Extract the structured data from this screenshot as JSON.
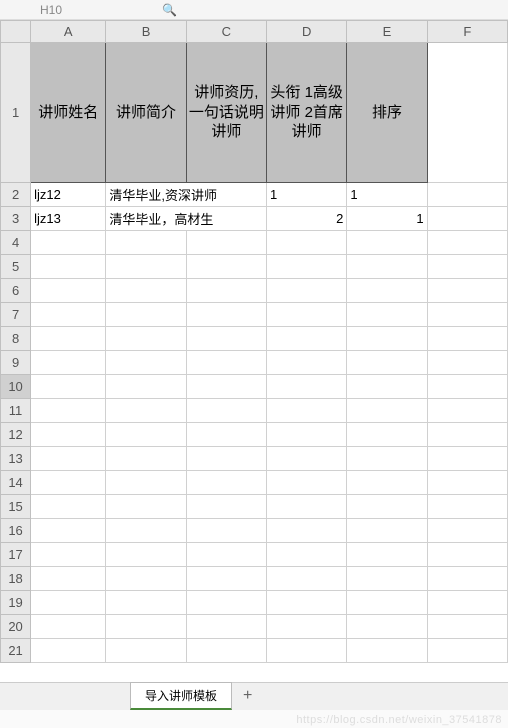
{
  "namebox": "H10",
  "columns": [
    "A",
    "B",
    "C",
    "D",
    "E",
    "F"
  ],
  "rowNumbers": [
    1,
    2,
    3,
    4,
    5,
    6,
    7,
    8,
    9,
    10,
    11,
    12,
    13,
    14,
    15,
    16,
    17,
    18,
    19,
    20,
    21
  ],
  "headers": {
    "A": "讲师姓名",
    "B": "讲师简介",
    "C": "讲师资历,一句话说明讲师",
    "D": "头衔 1高级讲师 2首席讲师",
    "E": "排序"
  },
  "rows": [
    {
      "A": "ljz12",
      "B": "清华毕业,资深讲师",
      "D": "1",
      "E": "1"
    },
    {
      "A": "ljz13",
      "B": "清华毕业，高材生",
      "D": "2",
      "E": "1"
    }
  ],
  "sheetName": "导入讲师模板",
  "addSheet": "+",
  "watermark": "https://blog.csdn.net/weixin_37541878",
  "selectedRow": 10
}
